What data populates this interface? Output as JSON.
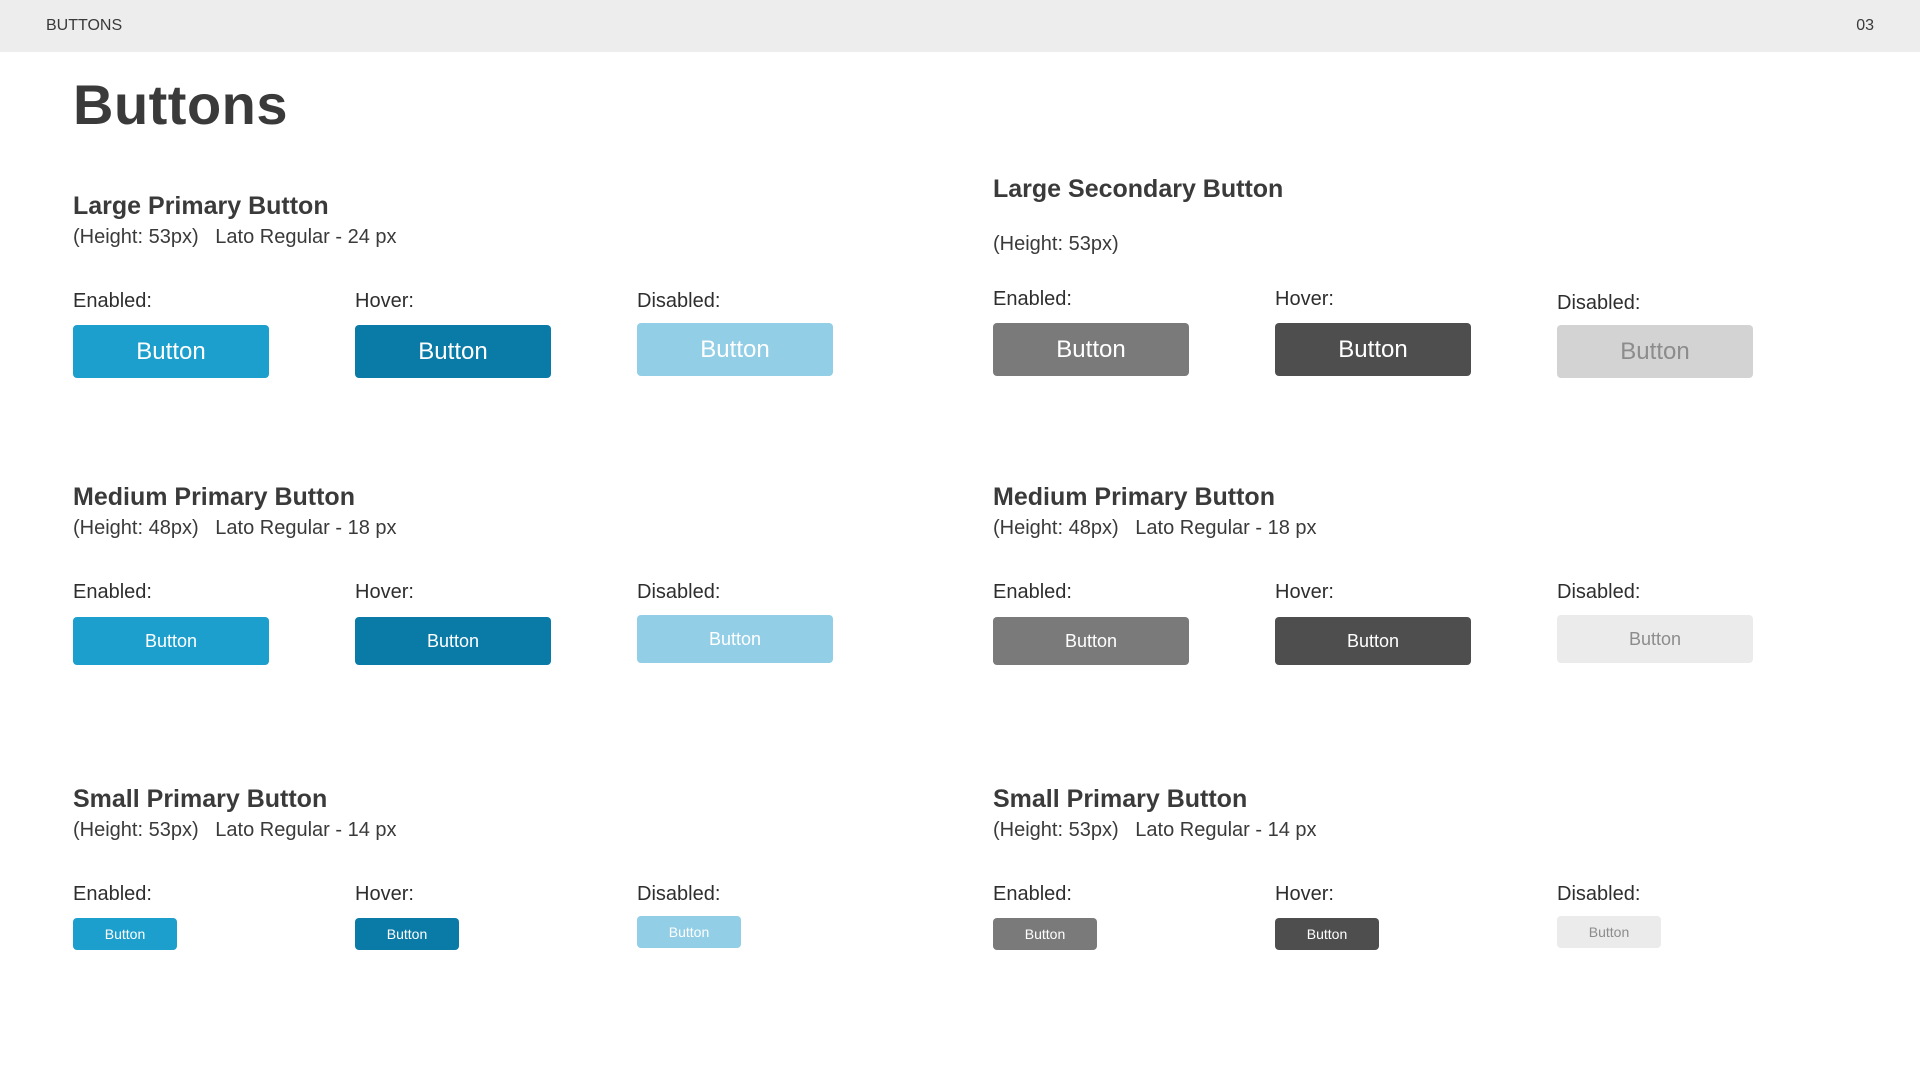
{
  "header": {
    "section_label": "BUTTONS",
    "page_number": "03"
  },
  "page_title": "Buttons",
  "state_labels": {
    "enabled": "Enabled:",
    "hover": "Hover:",
    "disabled": "Disabled:"
  },
  "button_text": "Button",
  "colors": {
    "primary_enabled": "#1c9fcd",
    "primary_hover": "#0a7aa6",
    "primary_disabled": "#92cee6",
    "secondary_enabled": "#7a7a7a",
    "secondary_hover": "#4e4e4e",
    "secondary_disabled": "#d3d3d3"
  },
  "sections": {
    "large_primary": {
      "title": "Large Primary Button",
      "spec": "(Height: 53px)   Lato Regular - 24 px"
    },
    "large_secondary": {
      "title": "Large Secondary Button",
      "spec": "(Height: 53px)"
    },
    "medium_primary": {
      "title": "Medium Primary Button",
      "spec": "(Height: 48px)   Lato Regular - 18 px"
    },
    "medium_secondary": {
      "title": "Medium Primary Button",
      "spec": "(Height: 48px)   Lato Regular - 18 px"
    },
    "small_primary": {
      "title": "Small Primary Button",
      "spec": "(Height: 53px)   Lato Regular - 14 px"
    },
    "small_secondary": {
      "title": "Small Primary Button",
      "spec": "(Height: 53px)   Lato Regular - 14 px"
    }
  }
}
